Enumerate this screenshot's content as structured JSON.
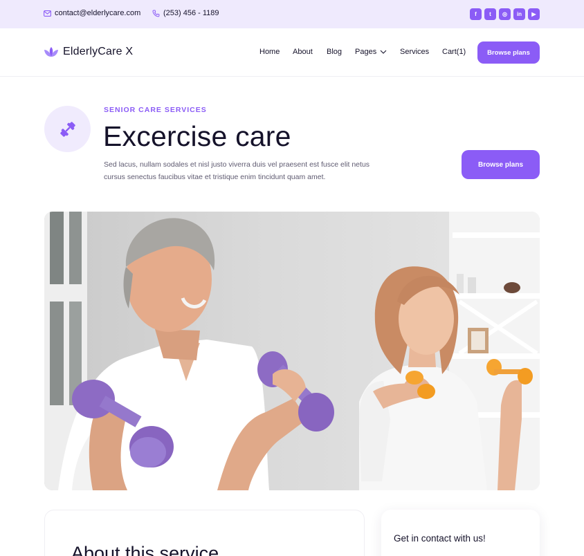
{
  "topbar": {
    "email": "contact@elderlycare.com",
    "phone": "(253) 456 - 1189",
    "socials": [
      {
        "icon": "facebook-icon",
        "glyph": "f"
      },
      {
        "icon": "twitter-icon",
        "glyph": "t"
      },
      {
        "icon": "instagram-icon",
        "glyph": "◎"
      },
      {
        "icon": "linkedin-icon",
        "glyph": "in"
      },
      {
        "icon": "youtube-icon",
        "glyph": "▶"
      }
    ]
  },
  "navbar": {
    "logo": "ElderlyCare X",
    "items": [
      "Home",
      "About",
      "Blog",
      "Pages",
      "Services",
      "Cart(1)"
    ],
    "cta": "Browse plans"
  },
  "hero": {
    "eyebrow": "SENIOR CARE SERVICES",
    "title": "Excercise care",
    "description": "Sed lacus, nullam sodales et nisl justo viverra duis vel praesent est fusce elit netus cursus senectus faucibus vitae et tristique enim tincidunt quam amet.",
    "cta": "Browse plans",
    "image": "Older man and woman exercising with purple and orange dumbbells"
  },
  "about": {
    "title": "About this service"
  },
  "contact": {
    "title": "Get in contact with us!"
  },
  "colors": {
    "accent": "#8b5cf6",
    "topbar_bg": "#efeafd",
    "text": "#15122a",
    "muted": "#5e5a70"
  }
}
